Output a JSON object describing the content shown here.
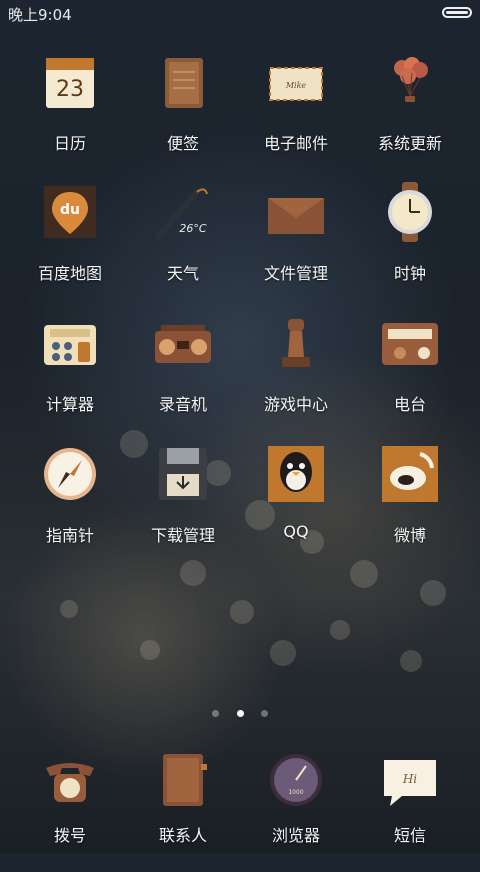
{
  "status": {
    "time": "晚上9:04"
  },
  "apps": [
    {
      "label": "日历",
      "icon": "calendar-icon",
      "date": "23"
    },
    {
      "label": "便签",
      "icon": "notes-icon"
    },
    {
      "label": "电子邮件",
      "icon": "email-icon",
      "envelope_text": "Mike"
    },
    {
      "label": "系统更新",
      "icon": "balloons-icon"
    },
    {
      "label": "百度地图",
      "icon": "baidu-map-icon",
      "badge": "du"
    },
    {
      "label": "天气",
      "icon": "umbrella-icon",
      "temp": "26°C"
    },
    {
      "label": "文件管理",
      "icon": "folder-icon"
    },
    {
      "label": "时钟",
      "icon": "watch-icon"
    },
    {
      "label": "计算器",
      "icon": "calculator-icon"
    },
    {
      "label": "录音机",
      "icon": "boombox-icon"
    },
    {
      "label": "游戏中心",
      "icon": "chess-icon"
    },
    {
      "label": "电台",
      "icon": "radio-icon"
    },
    {
      "label": "指南针",
      "icon": "compass-icon"
    },
    {
      "label": "下载管理",
      "icon": "floppy-icon"
    },
    {
      "label": "QQ",
      "icon": "qq-icon"
    },
    {
      "label": "微博",
      "icon": "weibo-icon"
    }
  ],
  "dock": [
    {
      "label": "拨号",
      "icon": "phone-icon"
    },
    {
      "label": "联系人",
      "icon": "contacts-book-icon"
    },
    {
      "label": "浏览器",
      "icon": "browser-icon"
    },
    {
      "label": "短信",
      "icon": "message-icon",
      "text": "Hi"
    }
  ],
  "pager": {
    "count": 3,
    "active": 2
  }
}
